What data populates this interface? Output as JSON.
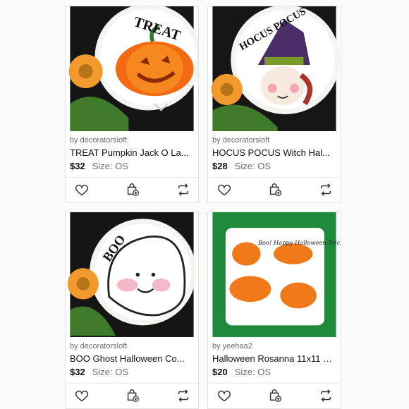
{
  "listings": [
    {
      "seller": "by decoratorsloft",
      "title": "TREAT Pumpkin Jack O La...",
      "price": "$32",
      "size": "Size: OS",
      "image_text": "TREAT"
    },
    {
      "seller": "by decoratorsloft",
      "title": "HOCUS POCUS Witch Hal...",
      "price": "$28",
      "size": "Size: OS",
      "image_text": "HOCUS POCUS"
    },
    {
      "seller": "by decoratorsloft",
      "title": "BOO Ghost Halloween Co...",
      "price": "$32",
      "size": "Size: OS",
      "image_text": "BOO"
    },
    {
      "seller": "by yeehaa2",
      "title": "Halloween Rosanna 11x11 Se...",
      "price": "$20",
      "size": "Size: OS",
      "image_text": "Boo! Happy Halloween Trick or Treat!"
    }
  ],
  "icons": {
    "like": "heart-icon",
    "bundle": "bag-plus-icon",
    "share": "share-arrows-icon"
  }
}
